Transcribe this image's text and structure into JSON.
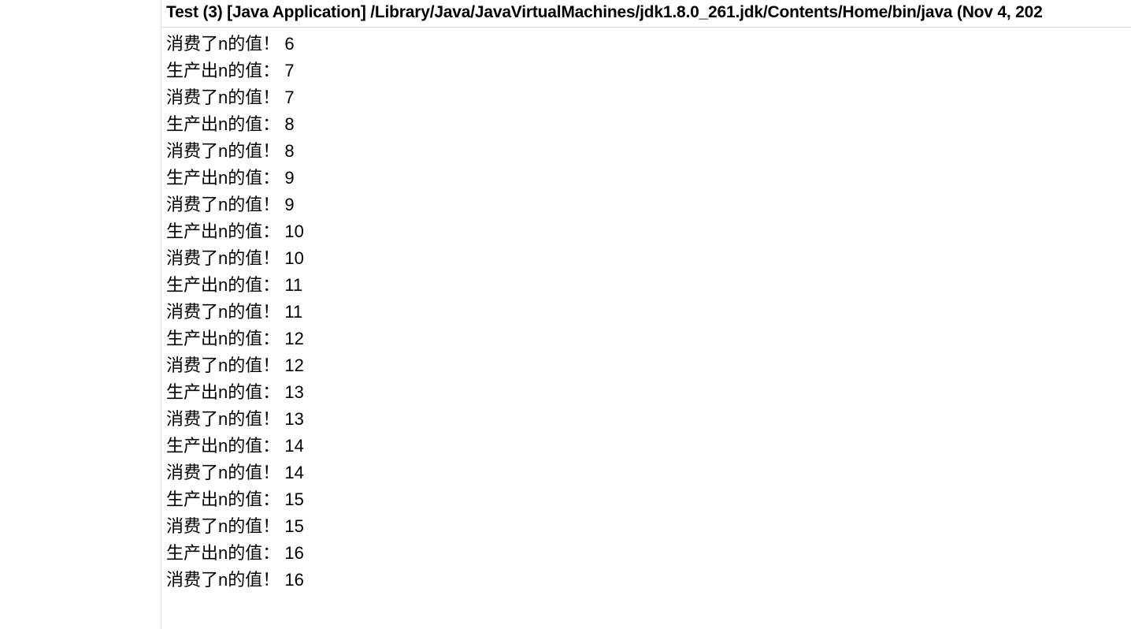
{
  "console": {
    "header": "Test (3) [Java Application] /Library/Java/JavaVirtualMachines/jdk1.8.0_261.jdk/Contents/Home/bin/java  (Nov 4, 202",
    "lines": [
      "消费了n的值！ 6",
      "生产出n的值： 7",
      "消费了n的值！ 7",
      "生产出n的值： 8",
      "消费了n的值！ 8",
      "生产出n的值： 9",
      "消费了n的值！ 9",
      "生产出n的值： 10",
      "消费了n的值！ 10",
      "生产出n的值： 11",
      "消费了n的值！ 11",
      "生产出n的值： 12",
      "消费了n的值！ 12",
      "生产出n的值： 13",
      "消费了n的值！ 13",
      "生产出n的值： 14",
      "消费了n的值！ 14",
      "生产出n的值： 15",
      "消费了n的值！ 15",
      "生产出n的值： 16",
      "消费了n的值！ 16"
    ]
  }
}
